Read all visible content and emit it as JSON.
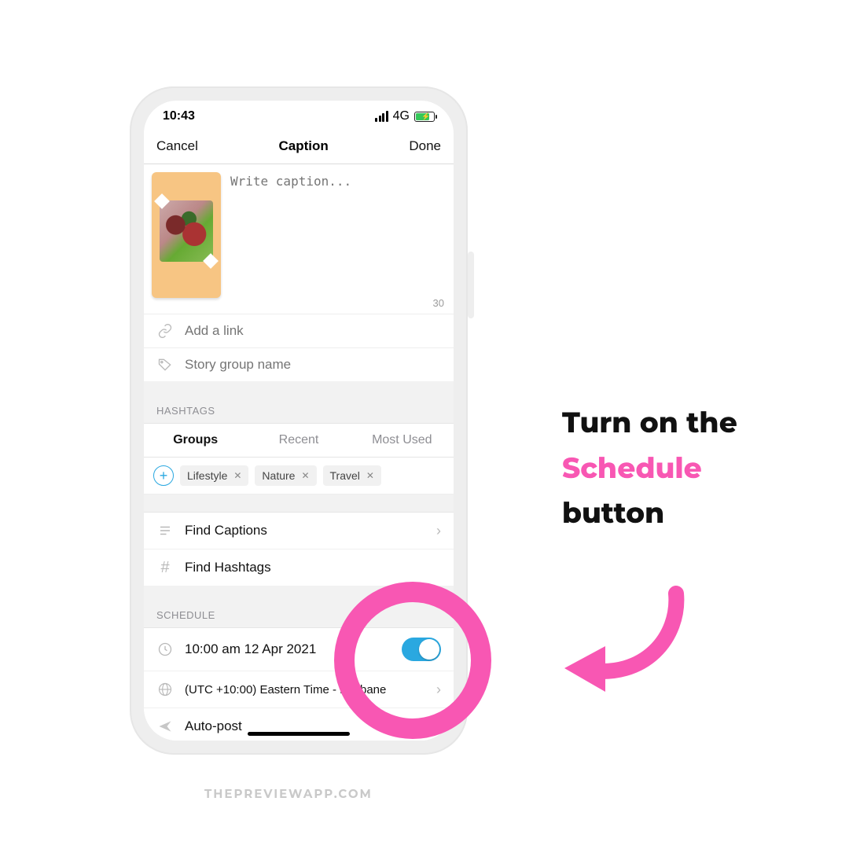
{
  "status": {
    "time": "10:43",
    "network": "4G"
  },
  "nav": {
    "cancel": "Cancel",
    "title": "Caption",
    "done": "Done"
  },
  "caption": {
    "placeholder": "Write caption...",
    "count": "30"
  },
  "links": {
    "add_link": "Add a link",
    "story_group": "Story group name"
  },
  "hashtags": {
    "header": "HASHTAGS",
    "tabs": {
      "groups": "Groups",
      "recent": "Recent",
      "most_used": "Most Used"
    },
    "chips": [
      {
        "label": "Lifestyle"
      },
      {
        "label": "Nature"
      },
      {
        "label": "Travel"
      }
    ]
  },
  "tools": {
    "find_captions": "Find Captions",
    "find_hashtags": "Find Hashtags"
  },
  "schedule": {
    "header": "SCHEDULE",
    "datetime": "10:00 am  12 Apr 2021",
    "timezone": "(UTC +10:00) Eastern Time - Brisbane",
    "autopost": "Auto-post"
  },
  "callout": {
    "line1": "Turn on the",
    "highlight": "Schedule",
    "line3": "button"
  },
  "footer": "THEPREVIEWAPP.COM",
  "colors": {
    "pink": "#f857b3",
    "switch": "#2aa8e0"
  }
}
